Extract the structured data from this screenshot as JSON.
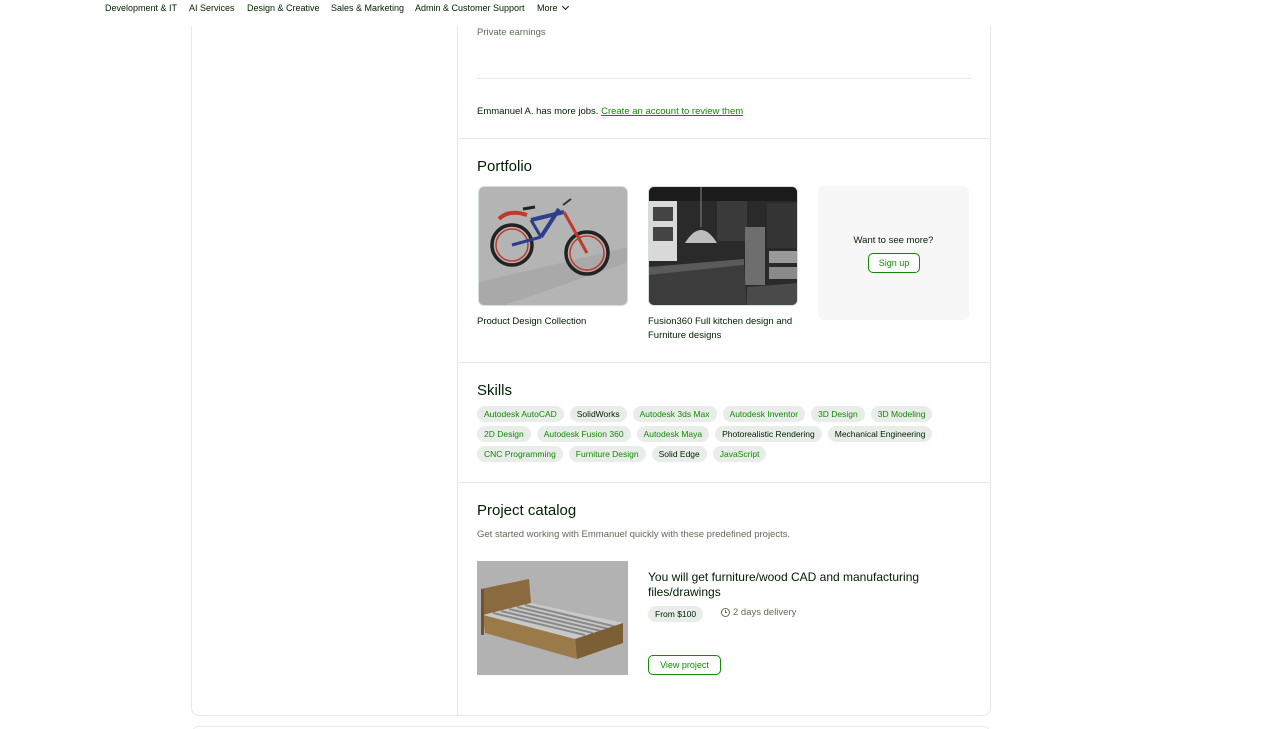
{
  "nav": {
    "items": [
      "Development & IT",
      "AI Services",
      "Design & Creative",
      "Sales & Marketing",
      "Admin & Customer Support"
    ],
    "more_label": "More"
  },
  "earnings": {
    "private_label": "Private earnings",
    "more_jobs_text": "Emmanuel A. has more jobs.",
    "more_jobs_link": "Create an account to review them"
  },
  "portfolio": {
    "heading": "Portfolio",
    "items": [
      {
        "title": "Product Design Collection",
        "image": "bicycle-render"
      },
      {
        "title": "Fusion360 Full kitchen design and Furniture designs",
        "image": "kitchen-render"
      }
    ],
    "see_more_text": "Want to see more?",
    "signup_label": "Sign up"
  },
  "skills": {
    "heading": "Skills",
    "items": [
      {
        "label": "Autodesk AutoCAD",
        "linked": true
      },
      {
        "label": "SolidWorks",
        "linked": false
      },
      {
        "label": "Autodesk 3ds Max",
        "linked": true
      },
      {
        "label": "Autodesk Inventor",
        "linked": true
      },
      {
        "label": "3D Design",
        "linked": true
      },
      {
        "label": "3D Modeling",
        "linked": true
      },
      {
        "label": "2D Design",
        "linked": true
      },
      {
        "label": "Autodesk Fusion 360",
        "linked": true
      },
      {
        "label": "Autodesk Maya",
        "linked": true
      },
      {
        "label": "Photorealistic Rendering",
        "linked": false
      },
      {
        "label": "Mechanical Engineering",
        "linked": false
      },
      {
        "label": "CNC Programming",
        "linked": true
      },
      {
        "label": "Furniture Design",
        "linked": true
      },
      {
        "label": "Solid Edge",
        "linked": false
      },
      {
        "label": "JavaScript",
        "linked": true
      }
    ]
  },
  "catalog": {
    "heading": "Project catalog",
    "subtitle": "Get started working with Emmanuel quickly with these predefined projects.",
    "project": {
      "title": "You will get furniture/wood CAD and manufacturing files/drawings",
      "price": "From $100",
      "delivery": "2 days delivery",
      "button": "View project",
      "image": "bed-render"
    }
  },
  "colors": {
    "accent": "#108a00",
    "text": "#001e00",
    "muted": "#5e6d55",
    "chip_bg": "#e9ede9",
    "border": "#e4ebe4"
  }
}
